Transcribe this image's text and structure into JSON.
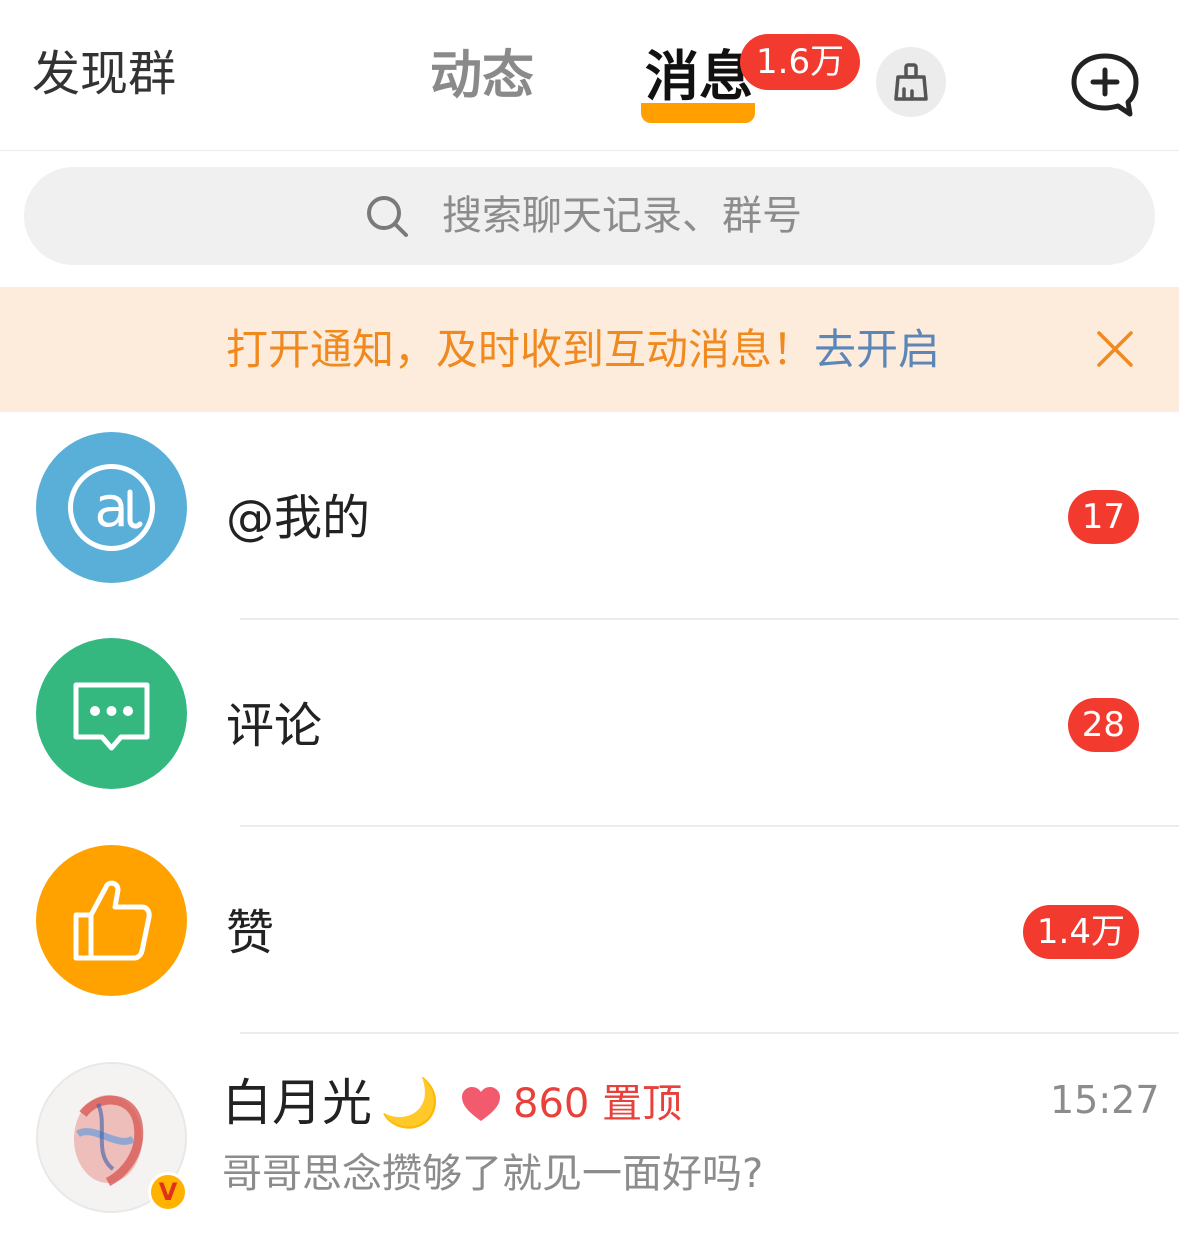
{
  "header": {
    "discover_label": "发现群",
    "tabs": [
      {
        "label": "动态"
      },
      {
        "label": "消息",
        "badge": "1.6万"
      }
    ],
    "clean_icon": "broom-icon",
    "add_icon": "chat-plus-icon"
  },
  "search": {
    "placeholder": "搜索聊天记录、群号"
  },
  "notice": {
    "text": "打开通知，及时收到互动消息！",
    "link": "去开启"
  },
  "categories": [
    {
      "label": "@我的",
      "badge": "17",
      "icon": "at-icon",
      "color": "#5aafd9"
    },
    {
      "label": "评论",
      "badge": "28",
      "icon": "comment-icon",
      "color": "#35b880"
    },
    {
      "label": "赞",
      "badge": "1.4万",
      "icon": "thumbs-up-icon",
      "color": "#ffa200"
    }
  ],
  "chats": [
    {
      "name": "白月光",
      "emoji": "🌙",
      "heart_count": "860",
      "pinned_label": "置顶",
      "time": "15:27",
      "preview": "哥哥思念攒够了就见一面好吗?",
      "verified_badge": "V"
    }
  ],
  "colors": {
    "accent_orange": "#ff9f00",
    "badge_red": "#f33a2f",
    "notice_bg": "#fdebdc",
    "notice_text": "#f08a1e",
    "link_blue": "#5b86b8"
  }
}
